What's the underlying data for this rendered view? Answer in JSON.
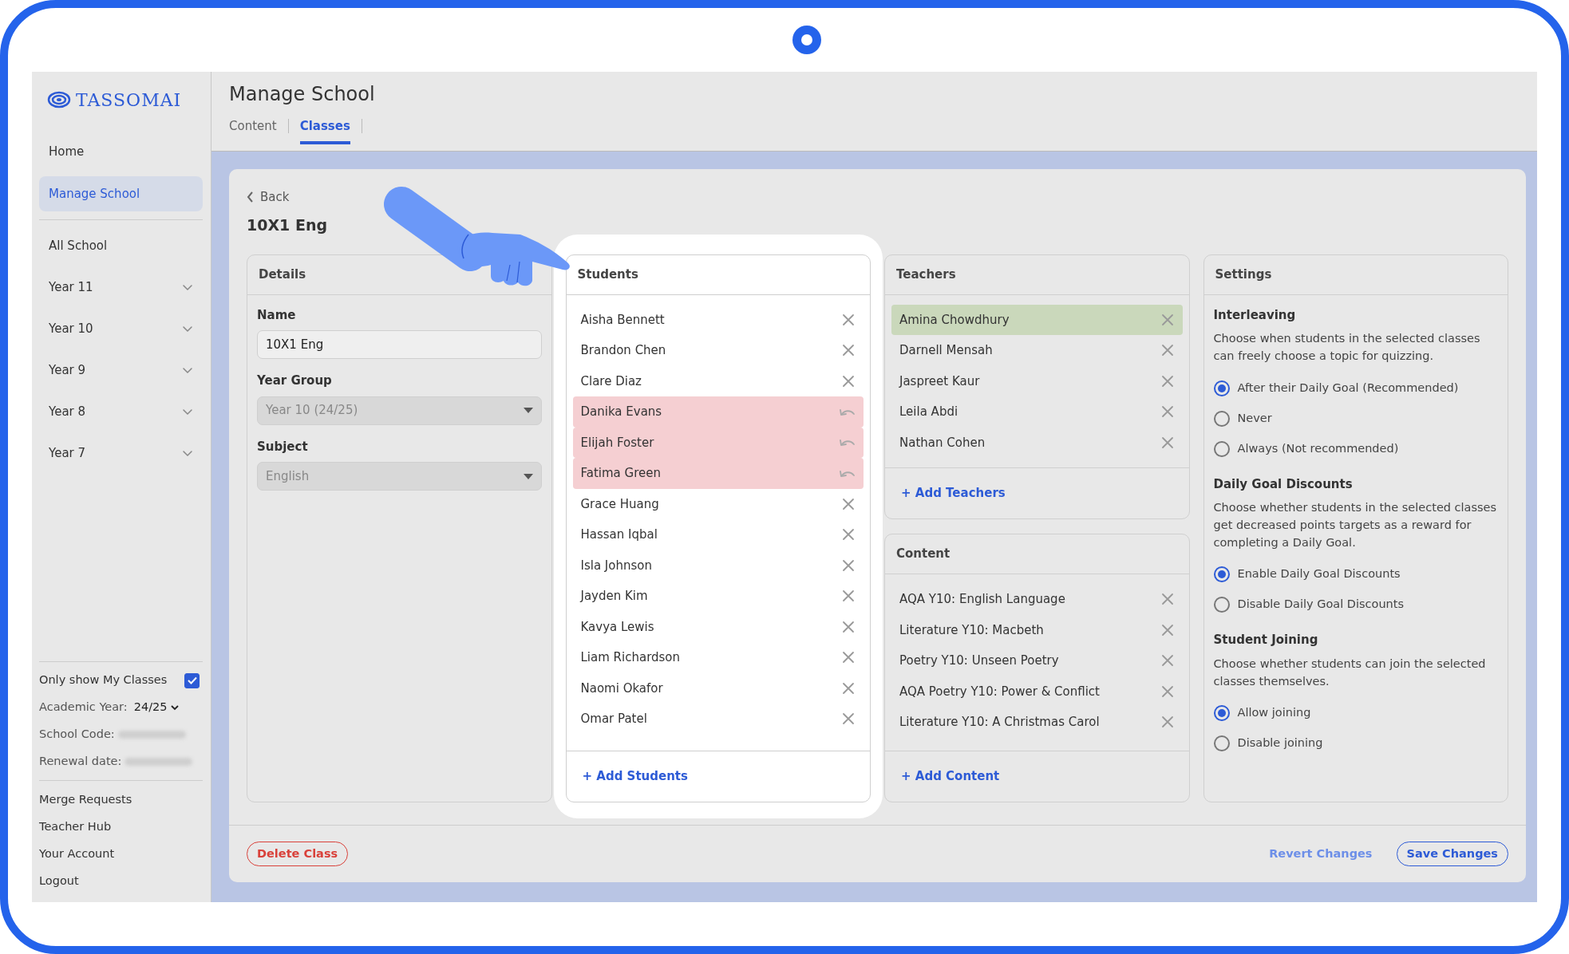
{
  "sidebar": {
    "logo": "TASSOMAI",
    "nav": [
      {
        "label": "Home",
        "selected": false
      },
      {
        "label": "Manage School",
        "selected": true
      }
    ],
    "groups": [
      {
        "label": "All School",
        "kind": "link"
      },
      {
        "label": "Year 11",
        "kind": "group",
        "expanded": false
      },
      {
        "label": "Year 10",
        "kind": "group",
        "expanded": false
      },
      {
        "label": "Year 9",
        "kind": "group",
        "expanded": false
      },
      {
        "label": "Year 8",
        "kind": "group",
        "expanded": false
      },
      {
        "label": "Year 7",
        "kind": "group",
        "expanded": false
      }
    ],
    "only_my_classes": {
      "label": "Only show My Classes",
      "checked": true
    },
    "academic_year": {
      "label": "Academic Year:",
      "value": "24/25"
    },
    "school_code": {
      "label": "School Code:"
    },
    "renewal_date": {
      "label": "Renewal date:"
    },
    "links": [
      "Merge Requests",
      "Teacher Hub",
      "Your Account",
      "Logout"
    ]
  },
  "header": {
    "title": "Manage School",
    "tabs": [
      {
        "label": "Content",
        "selected": false
      },
      {
        "label": "Classes",
        "selected": true
      }
    ]
  },
  "class_editor": {
    "back": "Back",
    "title": "10X1 Eng",
    "details": {
      "title": "Details",
      "fields": [
        {
          "label": "Name",
          "kind": "text",
          "value": "10X1 Eng",
          "disabled": false
        },
        {
          "label": "Year Group",
          "kind": "select",
          "value": "Year 10 (24/25)",
          "disabled": true
        },
        {
          "label": "Subject",
          "kind": "select",
          "value": "English",
          "disabled": true
        }
      ]
    },
    "students": {
      "title": "Students",
      "highlighted": true,
      "add": "+ Add Students",
      "items": [
        {
          "name": "Aisha Bennett",
          "kind": "current"
        },
        {
          "name": "Brandon Chen",
          "kind": "current"
        },
        {
          "name": "Clare Diaz",
          "kind": "current"
        },
        {
          "name": "Danika Evans",
          "kind": "removed"
        },
        {
          "name": "Elijah Foster",
          "kind": "removed"
        },
        {
          "name": "Fatima Green",
          "kind": "removed"
        },
        {
          "name": "Grace Huang",
          "kind": "current"
        },
        {
          "name": "Hassan Iqbal",
          "kind": "current"
        },
        {
          "name": "Isla Johnson",
          "kind": "current"
        },
        {
          "name": "Jayden Kim",
          "kind": "current"
        },
        {
          "name": "Kavya Lewis",
          "kind": "current"
        },
        {
          "name": "Liam Richardson",
          "kind": "current"
        },
        {
          "name": "Naomi Okafor",
          "kind": "current"
        },
        {
          "name": "Omar Patel",
          "kind": "current"
        }
      ]
    },
    "teachers": {
      "title": "Teachers",
      "highlighted": false,
      "add": "+ Add Teachers",
      "items": [
        {
          "name": "Amina Chowdhury",
          "kind": "added"
        },
        {
          "name": "Darnell Mensah",
          "kind": "current"
        },
        {
          "name": "Jaspreet Kaur",
          "kind": "current"
        },
        {
          "name": "Leila Abdi",
          "kind": "current"
        },
        {
          "name": "Nathan Cohen",
          "kind": "current"
        }
      ]
    },
    "content": {
      "title": "Content",
      "highlighted": false,
      "add": "+ Add Content",
      "items": [
        {
          "name": "AQA Y10: English Language",
          "kind": "current"
        },
        {
          "name": "Literature Y10: Macbeth",
          "kind": "current"
        },
        {
          "name": "Poetry Y10: Unseen Poetry",
          "kind": "current"
        },
        {
          "name": "AQA Poetry Y10: Power & Conflict",
          "kind": "current"
        },
        {
          "name": "Literature Y10: A Christmas Carol",
          "kind": "current"
        }
      ]
    },
    "settings": {
      "title": "Settings",
      "groups": [
        {
          "title": "Interleaving",
          "description": "Choose when students in the selected classes can freely choose a topic for quizzing.",
          "options": [
            {
              "label": "After their Daily Goal (Recommended)",
              "selected": true
            },
            {
              "label": "Never",
              "selected": false
            },
            {
              "label": "Always (Not recommended)",
              "selected": false
            }
          ]
        },
        {
          "title": "Daily Goal Discounts",
          "description": "Choose whether students in the selected classes get decreased points targets as a reward for completing a Daily Goal.",
          "options": [
            {
              "label": "Enable Daily Goal Discounts",
              "selected": true
            },
            {
              "label": "Disable Daily Goal Discounts",
              "selected": false
            }
          ]
        },
        {
          "title": "Student Joining",
          "description": "Choose whether students can join the selected classes themselves.",
          "options": [
            {
              "label": "Allow joining",
              "selected": true
            },
            {
              "label": "Disable joining",
              "selected": false
            }
          ]
        }
      ]
    },
    "footer": {
      "delete": "Delete Class",
      "revert": "Revert Changes",
      "save": "Save Changes"
    }
  }
}
